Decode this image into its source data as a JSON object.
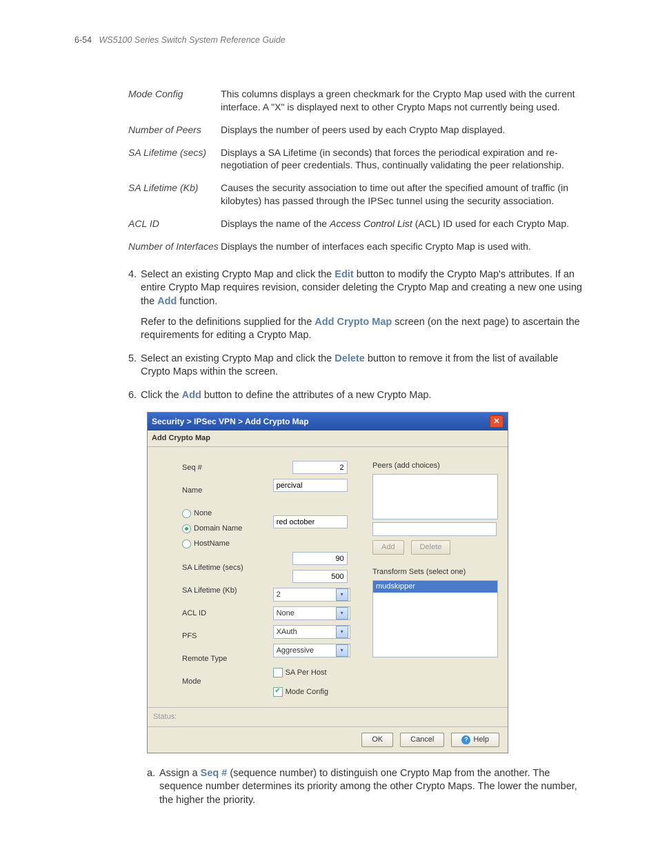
{
  "header": {
    "page_num": "6-54",
    "doc_title": "WS5100 Series Switch System Reference Guide"
  },
  "defs": {
    "mode_config": {
      "term": "Mode Config",
      "desc": "This columns displays a green checkmark for the Crypto Map used with the current interface. A \"X\" is displayed next to other Crypto Maps not currently being used."
    },
    "num_peers": {
      "term": "Number of Peers",
      "desc": "Displays the number of peers used by each Crypto Map displayed."
    },
    "sa_secs": {
      "term": "SA Lifetime (secs)",
      "desc": "Displays a SA Lifetime (in seconds) that forces the periodical expiration and re-negotiation of peer credentials. Thus, continually validating the peer relationship."
    },
    "sa_kb": {
      "term": "SA Lifetime (Kb)",
      "desc": "Causes the security association to time out after the specified amount of traffic (in kilobytes) has passed through the IPSec tunnel using the security association."
    },
    "acl_id": {
      "term": "ACL ID",
      "desc_pre": "Displays the name of the ",
      "desc_italic": "Access Control List",
      "desc_post": " (ACL) ID used for each Crypto Map."
    },
    "num_if": {
      "term": "Number of Interfaces",
      "desc": "Displays the number of interfaces each specific Crypto Map is used with."
    }
  },
  "steps": {
    "s4": {
      "p1_a": "Select an existing Crypto Map and click the ",
      "p1_b": "Edit",
      "p1_c": " button to modify the Crypto Map's attributes. If an entire Crypto Map requires revision, consider deleting the Crypto Map and creating a new one using the ",
      "p1_d": "Add",
      "p1_e": " function.",
      "p2_a": "Refer to the definitions supplied for the ",
      "p2_b": "Add Crypto Map",
      "p2_c": " screen (on the next page) to ascertain the requirements for editing a Crypto Map."
    },
    "s5": {
      "a": "Select an existing Crypto Map and click the ",
      "b": "Delete",
      "c": " button to remove it from the list of available Crypto Maps within the screen."
    },
    "s6": {
      "a": "Click the ",
      "b": "Add",
      "c": " button to define the attributes of a new Crypto Map."
    }
  },
  "dialog": {
    "breadcrumb": "Security > IPSec VPN > Add Crypto Map",
    "subtitle": "Add Crypto Map",
    "labels": {
      "seq": "Seq #",
      "name": "Name",
      "none": "None",
      "domain": "Domain Name",
      "host": "HostName",
      "sa_secs": "SA Lifetime (secs)",
      "sa_kb": "SA Lifetime (Kb)",
      "acl": "ACL ID",
      "pfs": "PFS",
      "remote": "Remote Type",
      "mode": "Mode",
      "sa_per_host": "SA Per Host",
      "mode_config": "Mode Config",
      "peers": "Peers (add choices)",
      "transform": "Transform Sets (select one)"
    },
    "values": {
      "seq": "2",
      "name": "percival",
      "domain": "red october",
      "sa_secs": "90",
      "sa_kb": "500",
      "acl": "2",
      "pfs": "None",
      "remote": "XAuth",
      "mode": "Aggressive",
      "transform_selected": "mudskipper"
    },
    "buttons": {
      "add": "Add",
      "delete": "Delete",
      "ok": "OK",
      "cancel": "Cancel",
      "help": "Help"
    },
    "status_label": "Status:"
  },
  "sub": {
    "a_pre": "Assign a ",
    "a_bold": "Seq #",
    "a_post": " (sequence number) to distinguish one Crypto Map from the another. The sequence number determines its priority among the other Crypto Maps. The lower the number, the higher the priority."
  }
}
